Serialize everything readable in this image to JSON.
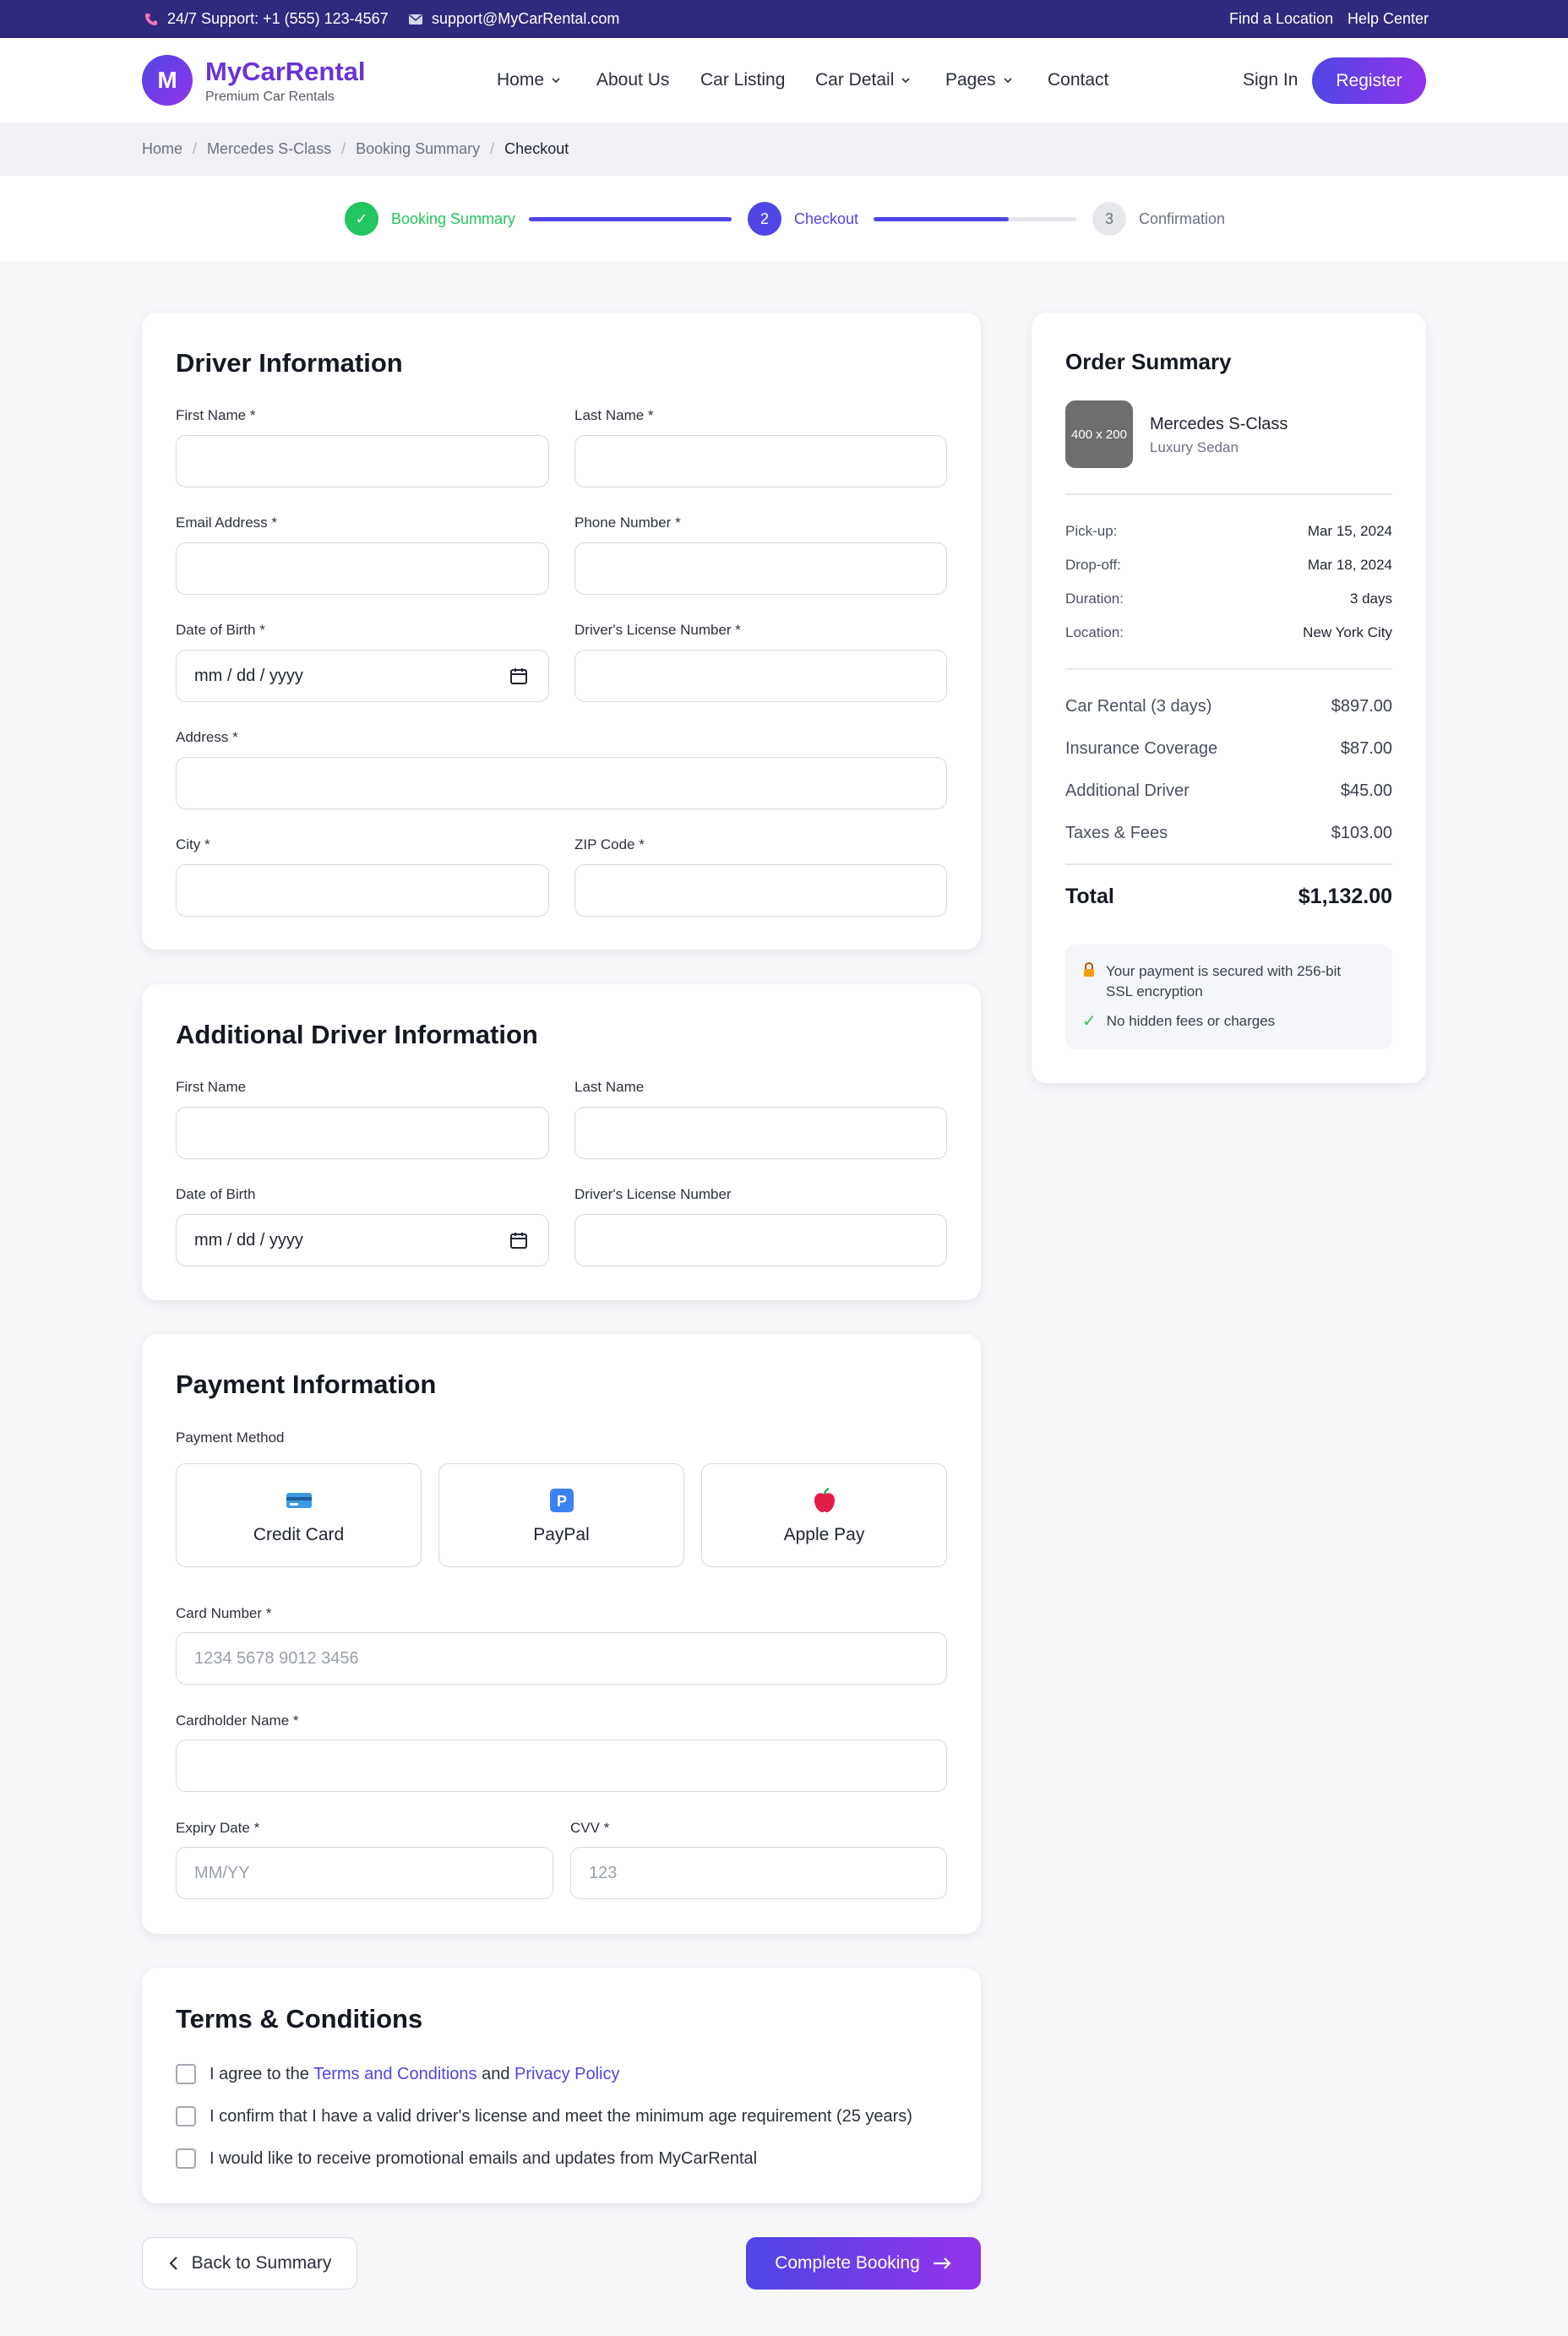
{
  "topbar": {
    "support": "24/7 Support: +1 (555) 123-4567",
    "email": "support@MyCarRental.com",
    "find_location": "Find a Location",
    "help_center": "Help Center"
  },
  "header": {
    "logo_letter": "M",
    "brand": "MyCarRental",
    "tagline": "Premium Car Rentals",
    "nav": [
      {
        "label": "Home",
        "dropdown": true
      },
      {
        "label": "About Us",
        "dropdown": false
      },
      {
        "label": "Car Listing",
        "dropdown": false
      },
      {
        "label": "Car Detail",
        "dropdown": true
      },
      {
        "label": "Pages",
        "dropdown": true
      },
      {
        "label": "Contact",
        "dropdown": false
      }
    ],
    "signin": "Sign In",
    "register": "Register"
  },
  "breadcrumb": [
    "Home",
    "Mercedes S-Class",
    "Booking Summary",
    "Checkout"
  ],
  "stepper": {
    "steps": [
      {
        "marker": "✓",
        "label": "Booking Summary",
        "state": "done"
      },
      {
        "marker": "2",
        "label": "Checkout",
        "state": "active"
      },
      {
        "marker": "3",
        "label": "Confirmation",
        "state": "pending"
      }
    ]
  },
  "driver": {
    "title": "Driver Information",
    "first_name": "First Name *",
    "last_name": "Last Name *",
    "email": "Email Address *",
    "phone": "Phone Number *",
    "dob": "Date of Birth *",
    "license": "Driver's License Number *",
    "address": "Address *",
    "city": "City *",
    "zip": "ZIP Code *",
    "date_placeholder": "mm / dd / yyyy"
  },
  "additional": {
    "title": "Additional Driver Information",
    "first_name": "First Name",
    "last_name": "Last Name",
    "dob": "Date of Birth",
    "license": "Driver's License Number",
    "date_placeholder": "mm / dd / yyyy"
  },
  "payment": {
    "title": "Payment Information",
    "method_label": "Payment Method",
    "methods": [
      {
        "label": "Credit Card",
        "icon": "credit-card-icon"
      },
      {
        "label": "PayPal",
        "icon": "paypal-icon"
      },
      {
        "label": "Apple Pay",
        "icon": "apple-icon"
      }
    ],
    "card_number_label": "Card Number *",
    "card_number_placeholder": "1234 5678 9012 3456",
    "cardholder_label": "Cardholder Name *",
    "expiry_label": "Expiry Date *",
    "expiry_placeholder": "MM/YY",
    "cvv_label": "CVV *",
    "cvv_placeholder": "123"
  },
  "terms": {
    "title": "Terms & Conditions",
    "row1_prefix": "I agree to the",
    "row1_link1": "Terms and Conditions",
    "row1_and": "and",
    "row1_link2": "Privacy Policy",
    "row2": "I confirm that I have a valid driver's license and meet the minimum age requirement (25 years)",
    "row3": "I would like to receive promotional emails and updates from MyCarRental"
  },
  "actions": {
    "back": "Back to Summary",
    "complete": "Complete Booking"
  },
  "summary": {
    "title": "Order Summary",
    "thumb": "400 x 200",
    "car_name": "Mercedes S-Class",
    "car_type": "Luxury Sedan",
    "details": [
      {
        "k": "Pick-up:",
        "v": "Mar 15, 2024"
      },
      {
        "k": "Drop-off:",
        "v": "Mar 18, 2024"
      },
      {
        "k": "Duration:",
        "v": "3 days"
      },
      {
        "k": "Location:",
        "v": "New York City"
      }
    ],
    "costs": [
      {
        "k": "Car Rental (3 days)",
        "v": "$897.00"
      },
      {
        "k": "Insurance Coverage",
        "v": "$87.00"
      },
      {
        "k": "Additional Driver",
        "v": "$45.00"
      },
      {
        "k": "Taxes & Fees",
        "v": "$103.00"
      }
    ],
    "total_label": "Total",
    "total_value": "$1,132.00",
    "secure_text": "Your payment is secured with 256-bit SSL encryption",
    "no_fees": "No hidden fees or charges"
  },
  "colors": {
    "topbar": "#2f2a7d",
    "accent": "#4f46e5",
    "accent2": "#9333ea",
    "success": "#22c55e"
  }
}
